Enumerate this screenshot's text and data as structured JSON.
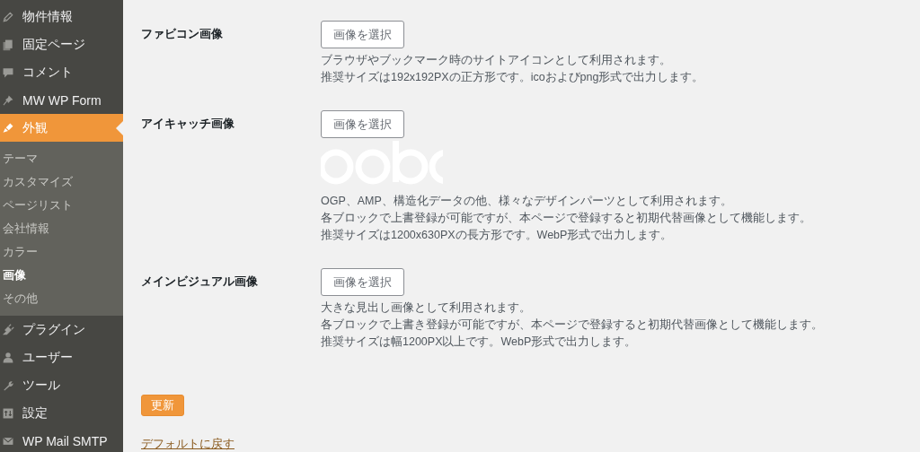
{
  "sidebar": {
    "items": [
      {
        "label": "物件情報",
        "selected": false
      },
      {
        "label": "固定ページ",
        "selected": false
      },
      {
        "label": "コメント",
        "selected": false
      },
      {
        "label": "MW WP Form",
        "selected": false
      },
      {
        "label": "外観",
        "selected": true,
        "children": [
          {
            "label": "テーマ",
            "selected": false
          },
          {
            "label": "カスタマイズ",
            "selected": false
          },
          {
            "label": "ページリスト",
            "selected": false
          },
          {
            "label": "会社情報",
            "selected": false
          },
          {
            "label": "カラー",
            "selected": false
          },
          {
            "label": "画像",
            "selected": true
          },
          {
            "label": "その他",
            "selected": false
          }
        ]
      },
      {
        "label": "プラグイン",
        "selected": false
      },
      {
        "label": "ユーザー",
        "selected": false
      },
      {
        "label": "ツール",
        "selected": false
      },
      {
        "label": "設定",
        "selected": false
      },
      {
        "label": "WP Mail SMTP",
        "selected": false
      }
    ]
  },
  "settings": [
    {
      "label": "ファビコン画像",
      "button": "画像を選択",
      "description": [
        "ブラウザやブックマーク時のサイトアイコンとして利用されます。",
        "推奨サイズは192x192PXの正方形です。icoおよびpng形式で出力します。"
      ]
    },
    {
      "label": "アイキャッチ画像",
      "button": "画像を選択",
      "description": [
        "OGP、AMP、構造化データの他、様々なデザインパーツとして利用されます。",
        "各ブロックで上書登録が可能ですが、本ページで登録すると初期代替画像として機能します。",
        "推奨サイズは1200x630PXの長方形です。WebP形式で出力します。"
      ]
    },
    {
      "label": "メインビジュアル画像",
      "button": "画像を選択",
      "description": [
        "大きな見出し画像として利用されます。",
        "各ブロックで上書き登録が可能ですが、本ページで登録すると初期代替画像として機能します。",
        "推奨サイズは幅1200PX以上です。WebP形式で出力します。"
      ]
    }
  ],
  "submit_button": "更新",
  "reset_link": "デフォルトに戻す"
}
